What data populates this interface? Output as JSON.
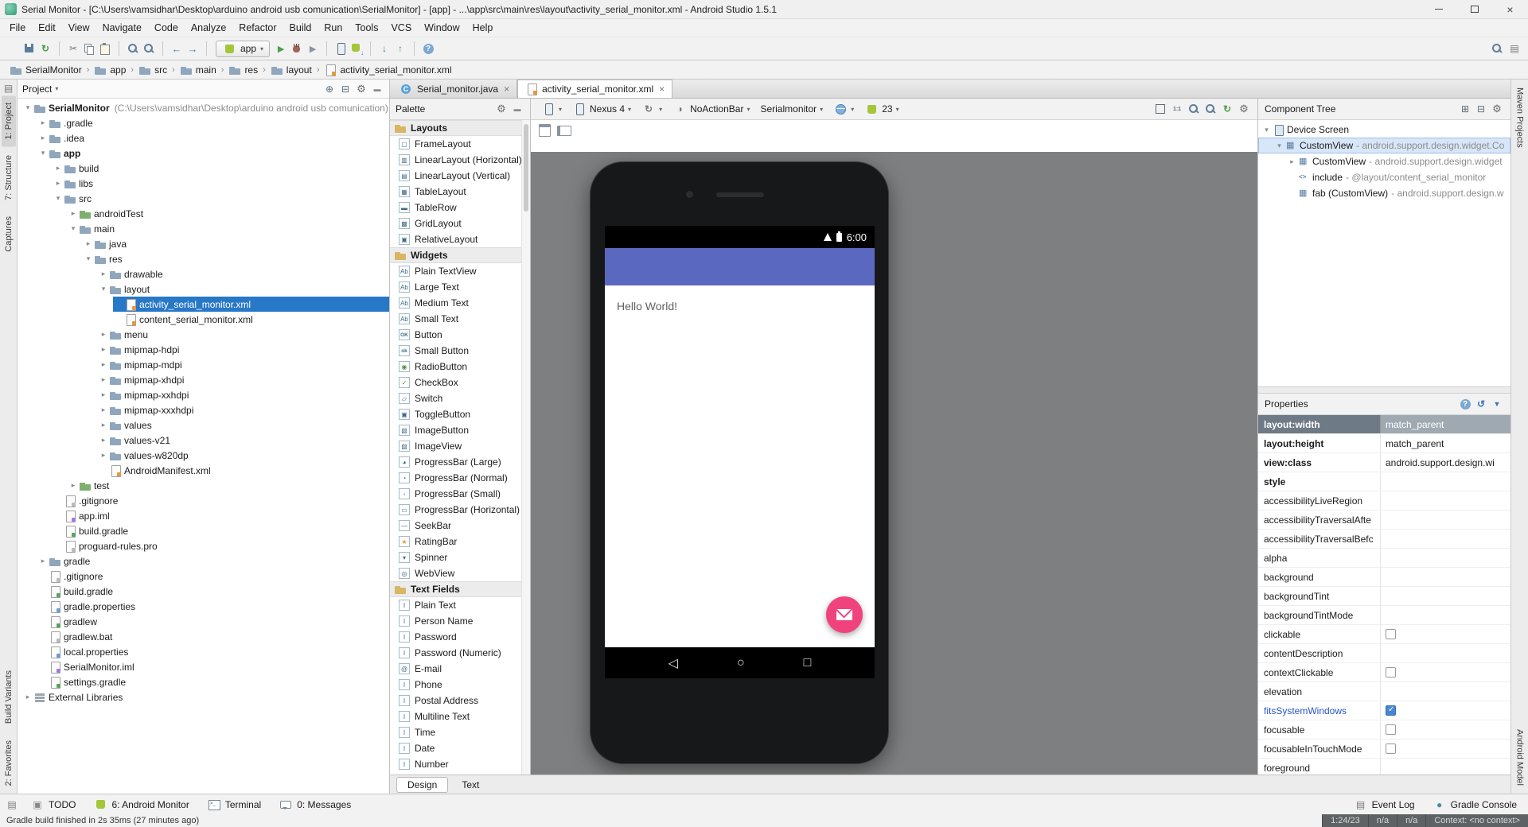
{
  "window": {
    "title": "Serial Monitor - [C:\\Users\\vamsidhar\\Desktop\\arduino android usb comunication\\SerialMonitor] - [app] - ...\\app\\src\\main\\res\\layout\\activity_serial_monitor.xml - Android Studio 1.5.1"
  },
  "menu": {
    "items": [
      "File",
      "Edit",
      "View",
      "Navigate",
      "Code",
      "Analyze",
      "Refactor",
      "Build",
      "Run",
      "Tools",
      "VCS",
      "Window",
      "Help"
    ]
  },
  "toolbar": {
    "run_config_label": "app",
    "groups": [
      [
        "open-icon",
        "save-icon",
        "sync-icon"
      ],
      [
        "cut-icon",
        "copy-icon",
        "paste-icon"
      ],
      [
        "find-icon",
        "replace-icon"
      ],
      [
        "back-icon",
        "forward-icon"
      ],
      [
        "run-config-combo",
        "run-icon",
        "debug-icon",
        "coverage-icon"
      ],
      [
        "avd-manager-icon",
        "sdk-manager-icon"
      ],
      [
        "vcs-update-icon",
        "vcs-commit-icon"
      ],
      [
        "help-icon"
      ]
    ],
    "right_icons": [
      "search-icon",
      "toolwindow-icon"
    ]
  },
  "breadcrumbs": {
    "items": [
      {
        "label": "SerialMonitor",
        "icon": "folder-icon"
      },
      {
        "label": "app",
        "icon": "folder-icon"
      },
      {
        "label": "src",
        "icon": "folder-icon"
      },
      {
        "label": "main",
        "icon": "folder-icon"
      },
      {
        "label": "res",
        "icon": "folder-icon"
      },
      {
        "label": "layout",
        "icon": "folder-icon"
      },
      {
        "label": "activity_serial_monitor.xml",
        "icon": "xml-file-icon"
      }
    ]
  },
  "left_stripe": {
    "top": [
      "1: Project",
      "7: Structure",
      "Captures"
    ],
    "bottom": [
      "Build Variants",
      "2: Favorites"
    ],
    "active": "1: Project"
  },
  "right_stripe": {
    "top": [
      "Maven Projects"
    ],
    "bottom": [
      "Android Model"
    ]
  },
  "project": {
    "header_title": "Project",
    "tree": [
      {
        "indent": 0,
        "arrow": "open",
        "icon": "folder-project-icon",
        "label": "SerialMonitor",
        "bold": true,
        "extra": "(C:\\Users\\vamsidhar\\Desktop\\arduino android usb comunication)"
      },
      {
        "indent": 1,
        "arrow": "closed",
        "icon": "folder-icon",
        "label": ".gradle"
      },
      {
        "indent": 1,
        "arrow": "closed",
        "icon": "folder-icon",
        "label": ".idea"
      },
      {
        "indent": 1,
        "arrow": "open",
        "icon": "folder-icon",
        "label": "app",
        "bold": true
      },
      {
        "indent": 2,
        "arrow": "closed",
        "icon": "folder-icon",
        "label": "build"
      },
      {
        "indent": 2,
        "arrow": "closed",
        "icon": "folder-icon",
        "label": "libs"
      },
      {
        "indent": 2,
        "arrow": "open",
        "icon": "folder-icon",
        "label": "src"
      },
      {
        "indent": 3,
        "arrow": "closed",
        "icon": "folder-green-icon",
        "label": "androidTest"
      },
      {
        "indent": 3,
        "arrow": "open",
        "icon": "folder-icon",
        "label": "main"
      },
      {
        "indent": 4,
        "arrow": "closed",
        "icon": "folder-icon",
        "label": "java"
      },
      {
        "indent": 4,
        "arrow": "open",
        "icon": "folder-icon",
        "label": "res"
      },
      {
        "indent": 5,
        "arrow": "closed",
        "icon": "folder-icon",
        "label": "drawable"
      },
      {
        "indent": 5,
        "arrow": "open",
        "icon": "folder-icon",
        "label": "layout"
      },
      {
        "indent": 6,
        "arrow": "none",
        "icon": "file-xml-icon",
        "label": "activity_serial_monitor.xml",
        "selected": true
      },
      {
        "indent": 6,
        "arrow": "none",
        "icon": "file-xml-icon",
        "label": "content_serial_monitor.xml"
      },
      {
        "indent": 5,
        "arrow": "closed",
        "icon": "folder-icon",
        "label": "menu"
      },
      {
        "indent": 5,
        "arrow": "closed",
        "icon": "folder-icon",
        "label": "mipmap-hdpi"
      },
      {
        "indent": 5,
        "arrow": "closed",
        "icon": "folder-icon",
        "label": "mipmap-mdpi"
      },
      {
        "indent": 5,
        "arrow": "closed",
        "icon": "folder-icon",
        "label": "mipmap-xhdpi"
      },
      {
        "indent": 5,
        "arrow": "closed",
        "icon": "folder-icon",
        "label": "mipmap-xxhdpi"
      },
      {
        "indent": 5,
        "arrow": "closed",
        "icon": "folder-icon",
        "label": "mipmap-xxxhdpi"
      },
      {
        "indent": 5,
        "arrow": "closed",
        "icon": "folder-icon",
        "label": "values"
      },
      {
        "indent": 5,
        "arrow": "closed",
        "icon": "folder-icon",
        "label": "values-v21"
      },
      {
        "indent": 5,
        "arrow": "closed",
        "icon": "folder-icon",
        "label": "values-w820dp"
      },
      {
        "indent": 5,
        "arrow": "none",
        "icon": "file-manifest-icon",
        "label": "AndroidManifest.xml"
      },
      {
        "indent": 3,
        "arrow": "closed",
        "icon": "folder-green-icon",
        "label": "test"
      },
      {
        "indent": 2,
        "arrow": "none",
        "icon": "file-text-icon",
        "label": ".gitignore"
      },
      {
        "indent": 2,
        "arrow": "none",
        "icon": "file-iml-icon",
        "label": "app.iml"
      },
      {
        "indent": 2,
        "arrow": "none",
        "icon": "file-gradle-icon",
        "label": "build.gradle"
      },
      {
        "indent": 2,
        "arrow": "none",
        "icon": "file-text-icon",
        "label": "proguard-rules.pro"
      },
      {
        "indent": 1,
        "arrow": "closed",
        "icon": "folder-icon",
        "label": "gradle"
      },
      {
        "indent": 1,
        "arrow": "none",
        "icon": "file-text-icon",
        "label": ".gitignore"
      },
      {
        "indent": 1,
        "arrow": "none",
        "icon": "file-gradle-icon",
        "label": "build.gradle"
      },
      {
        "indent": 1,
        "arrow": "none",
        "icon": "file-properties-icon",
        "label": "gradle.properties"
      },
      {
        "indent": 1,
        "arrow": "none",
        "icon": "file-gradlew-icon",
        "label": "gradlew"
      },
      {
        "indent": 1,
        "arrow": "none",
        "icon": "file-text-icon",
        "label": "gradlew.bat"
      },
      {
        "indent": 1,
        "arrow": "none",
        "icon": "file-properties-icon",
        "label": "local.properties"
      },
      {
        "indent": 1,
        "arrow": "none",
        "icon": "file-iml-icon",
        "label": "SerialMonitor.iml"
      },
      {
        "indent": 1,
        "arrow": "none",
        "icon": "file-gradle-icon",
        "label": "settings.gradle"
      },
      {
        "indent": 0,
        "arrow": "closed",
        "icon": "lib-icon",
        "label": "External Libraries"
      }
    ]
  },
  "editor": {
    "tabs": [
      {
        "label": "Serial_monitor.java",
        "icon": "java-file-icon",
        "active": false
      },
      {
        "label": "activity_serial_monitor.xml",
        "icon": "xml-file-icon",
        "active": true
      }
    ],
    "bottom_tabs": [
      {
        "label": "Design",
        "active": true
      },
      {
        "label": "Text",
        "active": false
      }
    ]
  },
  "palette": {
    "title": "Palette",
    "sections": [
      {
        "label": "Layouts",
        "items": [
          {
            "label": "FrameLayout",
            "icon": "frame-layout-icon"
          },
          {
            "label": "LinearLayout (Horizontal)",
            "icon": "linear-h-icon"
          },
          {
            "label": "LinearLayout (Vertical)",
            "icon": "linear-v-icon"
          },
          {
            "label": "TableLayout",
            "icon": "table-layout-icon"
          },
          {
            "label": "TableRow",
            "icon": "table-row-icon"
          },
          {
            "label": "GridLayout",
            "icon": "grid-layout-icon"
          },
          {
            "label": "RelativeLayout",
            "icon": "relative-layout-icon"
          }
        ]
      },
      {
        "label": "Widgets",
        "items": [
          {
            "label": "Plain TextView",
            "icon": "textview-icon"
          },
          {
            "label": "Large Text",
            "icon": "large-text-icon"
          },
          {
            "label": "Medium Text",
            "icon": "medium-text-icon"
          },
          {
            "label": "Small Text",
            "icon": "small-text-icon"
          },
          {
            "label": "Button",
            "icon": "button-icon"
          },
          {
            "label": "Small Button",
            "icon": "small-button-icon"
          },
          {
            "label": "RadioButton",
            "icon": "radiobutton-icon"
          },
          {
            "label": "CheckBox",
            "icon": "checkbox-icon"
          },
          {
            "label": "Switch",
            "icon": "switch-icon"
          },
          {
            "label": "ToggleButton",
            "icon": "togglebutton-icon"
          },
          {
            "label": "ImageButton",
            "icon": "imagebutton-icon"
          },
          {
            "label": "ImageView",
            "icon": "imageview-icon"
          },
          {
            "label": "ProgressBar (Large)",
            "icon": "progressbar-large-icon"
          },
          {
            "label": "ProgressBar (Normal)",
            "icon": "progressbar-normal-icon"
          },
          {
            "label": "ProgressBar (Small)",
            "icon": "progressbar-small-icon"
          },
          {
            "label": "ProgressBar (Horizontal)",
            "icon": "progressbar-horizontal-icon"
          },
          {
            "label": "SeekBar",
            "icon": "seekbar-icon"
          },
          {
            "label": "RatingBar",
            "icon": "ratingbar-icon"
          },
          {
            "label": "Spinner",
            "icon": "spinner-icon"
          },
          {
            "label": "WebView",
            "icon": "webview-icon"
          }
        ]
      },
      {
        "label": "Text Fields",
        "items": [
          {
            "label": "Plain Text",
            "icon": "plaintext-icon"
          },
          {
            "label": "Person Name",
            "icon": "personname-icon"
          },
          {
            "label": "Password",
            "icon": "password-icon"
          },
          {
            "label": "Password (Numeric)",
            "icon": "password-numeric-icon"
          },
          {
            "label": "E-mail",
            "icon": "email-icon"
          },
          {
            "label": "Phone",
            "icon": "phone-icon"
          },
          {
            "label": "Postal Address",
            "icon": "postal-icon"
          },
          {
            "label": "Multiline Text",
            "icon": "multiline-icon"
          },
          {
            "label": "Time",
            "icon": "time-icon"
          },
          {
            "label": "Date",
            "icon": "date-icon"
          },
          {
            "label": "Number",
            "icon": "number-icon"
          }
        ]
      }
    ]
  },
  "design_toolbar": {
    "device_label": "Nexus 4",
    "theme_label": "NoActionBar",
    "activity_label": "Serialmonitor",
    "api_label": "23"
  },
  "preview": {
    "status_time": "6:00",
    "content_text": "Hello World!",
    "appbar_color": "#5B68C0",
    "fab_color": "#F0437E"
  },
  "component_tree": {
    "title": "Component Tree",
    "items": [
      {
        "indent": 0,
        "arrow": "open",
        "icon": "device-screen-icon",
        "name": "Device Screen",
        "type": ""
      },
      {
        "indent": 1,
        "arrow": "open",
        "icon": "viewgroup-icon",
        "name": "CustomView",
        "type": "android.support.design.widget.Co",
        "selected": true
      },
      {
        "indent": 2,
        "arrow": "closed",
        "icon": "viewgroup-icon",
        "name": "CustomView",
        "type": "android.support.design.widget"
      },
      {
        "indent": 2,
        "arrow": "none",
        "icon": "include-icon",
        "name": "include",
        "type": "@layout/content_serial_monitor"
      },
      {
        "indent": 2,
        "arrow": "none",
        "icon": "viewgroup-icon",
        "name": "fab (CustomView)",
        "type": "android.support.design.w"
      }
    ]
  },
  "properties": {
    "title": "Properties",
    "rows": [
      {
        "name": "layout:width",
        "value": "match_parent",
        "bold": true,
        "selected": true
      },
      {
        "name": "layout:height",
        "value": "match_parent",
        "bold": true
      },
      {
        "name": "view:class",
        "value": "android.support.design.wi",
        "bold": true
      },
      {
        "name": "style",
        "value": "",
        "bold": true
      },
      {
        "name": "accessibilityLiveRegion",
        "value": ""
      },
      {
        "name": "accessibilityTraversalAfte",
        "value": ""
      },
      {
        "name": "accessibilityTraversalBefc",
        "value": ""
      },
      {
        "name": "alpha",
        "value": ""
      },
      {
        "name": "background",
        "value": ""
      },
      {
        "name": "backgroundTint",
        "value": ""
      },
      {
        "name": "backgroundTintMode",
        "value": ""
      },
      {
        "name": "clickable",
        "checkbox": true,
        "checked": false
      },
      {
        "name": "contentDescription",
        "value": ""
      },
      {
        "name": "contextClickable",
        "checkbox": true,
        "checked": false
      },
      {
        "name": "elevation",
        "value": ""
      },
      {
        "name": "fitsSystemWindows",
        "checkbox": true,
        "checked": true,
        "link": true
      },
      {
        "name": "focusable",
        "checkbox": true,
        "checked": false
      },
      {
        "name": "focusableInTouchMode",
        "checkbox": true,
        "checked": false
      },
      {
        "name": "foreground",
        "value": ""
      }
    ]
  },
  "tool_buttons": {
    "left": [
      {
        "label": "TODO",
        "icon": "todo-icon"
      },
      {
        "label": "6: Android Monitor",
        "icon": "android-icon"
      },
      {
        "label": "Terminal",
        "icon": "terminal-icon"
      },
      {
        "label": "0: Messages",
        "icon": "messages-icon"
      }
    ],
    "right": [
      {
        "label": "Event Log",
        "icon": "event-log-icon"
      },
      {
        "label": "Gradle Console",
        "icon": "gradle-console-icon"
      }
    ]
  },
  "status": {
    "message": "Gradle build finished in 2s 35ms (27 minutes ago)",
    "segments": [
      "1:24/23",
      "n/a",
      "n/a",
      "Context: <no context>"
    ]
  }
}
